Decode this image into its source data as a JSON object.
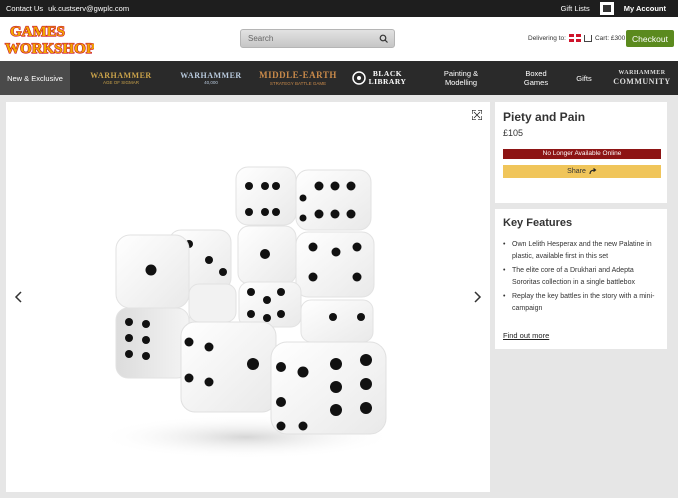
{
  "topbar": {
    "contact": "Contact Us",
    "email": "uk.custserv@gwplc.com",
    "gift_lists": "Gift Lists",
    "my_account": "My Account"
  },
  "header": {
    "logo_line1": "GAMES",
    "logo_line2": "WORKSHOP",
    "search_placeholder": "Search",
    "delivering_to": "Delivering to:",
    "cart": "Cart: £300 (8)",
    "checkout": "Checkout"
  },
  "nav": {
    "new_exclusive": "New & Exclusive",
    "age_of_sigmar": "WARHAMMER",
    "age_of_sigmar_sub": "AGE OF SIGMAR",
    "warhammer_40k": "WARHAMMER",
    "warhammer_40k_sub": "40,000",
    "middle_earth": "MIDDLE-EARTH",
    "middle_earth_sub": "STRATEGY BATTLE GAME",
    "black_library": "BLACK LIBRARY",
    "painting": "Painting & Modelling",
    "boxed_games": "Boxed Games",
    "gifts": "Gifts",
    "community": "WARHAMMER",
    "community_sub": "COMMUNITY"
  },
  "product": {
    "title": "Piety and Pain",
    "price": "£105",
    "status": "No Longer Available Online",
    "share": "Share"
  },
  "features": {
    "title": "Key Features",
    "items": [
      "Own Lelith Hesperax and the new Palatine in plastic, available first in this set",
      "The elite core of a Drukhari and Adepta Sororitas collection in a single battlebox",
      "Replay the key battles in the story with a mini-campaign"
    ],
    "find_out_more": "Find out more"
  },
  "colors": {
    "topbar": "#1e1e1e",
    "nav": "#2a2a2a",
    "checkout": "#5b8a1e",
    "status": "#8d1414",
    "share": "#f0c55a"
  }
}
